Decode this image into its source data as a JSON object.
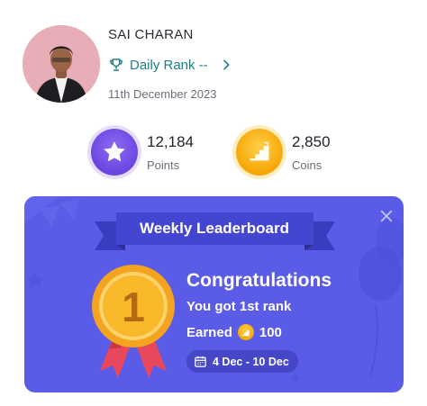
{
  "profile": {
    "name": "SAI CHARAN",
    "rank_label": "Daily Rank --",
    "date": "11th December 2023"
  },
  "stats": {
    "points": {
      "value": "12,184",
      "label": "Points"
    },
    "coins": {
      "value": "2,850",
      "label": "Coins"
    }
  },
  "leaderboard_card": {
    "banner": "Weekly Leaderboard",
    "medal_rank": "1",
    "title": "Congratulations",
    "subtitle": "You got 1st rank",
    "earned_label": "Earned",
    "earned_value": "100",
    "date_range": "4 Dec - 10 Dec"
  },
  "colors": {
    "card_bg": "#5a5ce8",
    "banner": "#4446d2",
    "rank_teal": "#1e7f86",
    "points_purple": "#6a45e0",
    "coins_gold": "#f5a300",
    "medal_gold": "#f7b829",
    "ribbon_red": "#e8485b"
  },
  "icons": [
    "trophy-icon",
    "chevron-right-icon",
    "star-icon",
    "stairs-icon",
    "close-icon",
    "medal-icon",
    "coin-icon",
    "calendar-icon"
  ]
}
